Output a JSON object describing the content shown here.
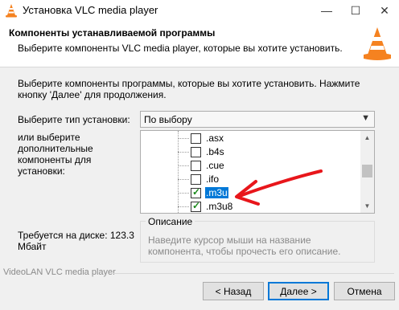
{
  "window": {
    "title": "Установка VLC media player",
    "minimize_glyph": "—",
    "maximize_glyph": "☐",
    "close_glyph": "✕"
  },
  "header": {
    "title": "Компоненты устанавливаемой программы",
    "subtitle": "Выберите компоненты VLC media player, которые вы хотите установить."
  },
  "intro": "Выберите компоненты программы, которые вы хотите установить. Нажмите кнопку 'Далее' для продолжения.",
  "install_type": {
    "label": "Выберите тип установки:",
    "value": "По выбору"
  },
  "components": {
    "label": "или выберите дополнительные компоненты для установки:",
    "items": [
      {
        "label": ".asx",
        "checked": false
      },
      {
        "label": ".b4s",
        "checked": false
      },
      {
        "label": ".cue",
        "checked": false
      },
      {
        "label": ".ifo",
        "checked": false
      },
      {
        "label": ".m3u",
        "checked": true,
        "selected": true
      },
      {
        "label": ".m3u8",
        "checked": true
      }
    ]
  },
  "disk": "Требуется на диске: 123.3 Мбайт",
  "description": {
    "legend": "Описание",
    "text": "Наведите курсор мыши на название компонента, чтобы прочесть его описание."
  },
  "vendor": "VideoLAN VLC media player",
  "buttons": {
    "back": "< Назад",
    "next": "Далее >",
    "cancel": "Отмена"
  },
  "colors": {
    "accent": "#0078d7",
    "annotation": "#e8161b",
    "check": "#1b8a1b"
  },
  "icons": {
    "app": "vlc-cone-icon",
    "dropdown": "chevron-down-icon"
  }
}
